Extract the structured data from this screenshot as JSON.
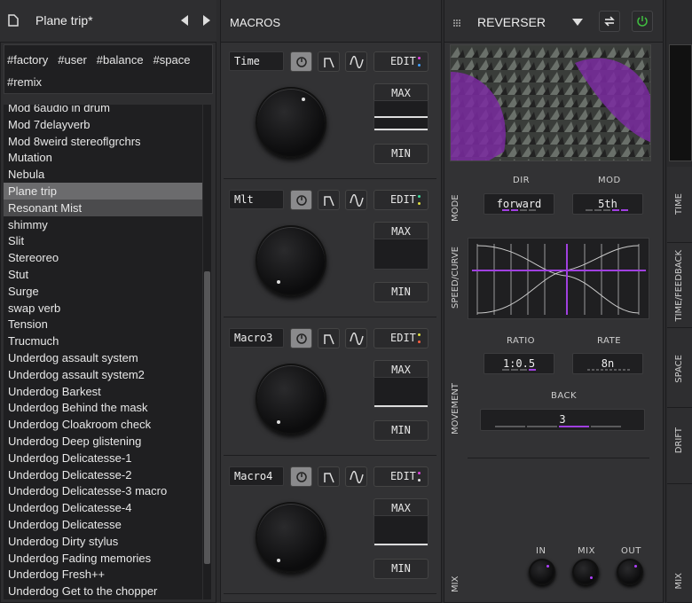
{
  "header": {
    "preset_name": "Plane trip*"
  },
  "tags": [
    "#factory",
    "#user",
    "#balance",
    "#space",
    "#remix"
  ],
  "presets": [
    "Mod 6audio in drum",
    "Mod 7delayverb",
    "Mod 8weird stereoflgrchrs",
    "Mutation",
    "Nebula",
    "Plane trip",
    "Resonant Mist",
    "shimmy",
    "Slit",
    "Stereoreo",
    "Stut",
    "Surge",
    "swap verb",
    "Tension",
    "Trucmuch",
    "Underdog assault system",
    "Underdog assault system2",
    "Underdog Barkest",
    "Underdog Behind the mask",
    "Underdog Cloakroom check",
    "Underdog Deep glistening",
    "Underdog Delicatesse-1",
    "Underdog Delicatesse-2",
    "Underdog Delicatesse-3 macro",
    "Underdog Delicatesse-4",
    "Underdog Delicatesse",
    "Underdog Dirty stylus",
    "Underdog Fading memories",
    "Underdog Fresh++",
    "Underdog Get to the chopper"
  ],
  "selected_preset": "Plane trip",
  "macros": {
    "title": "MACROS",
    "edit_label": "EDIT",
    "max_label": "MAX",
    "min_label": "MIN",
    "items": [
      {
        "name": "Time",
        "dots": [
          "#e040e0",
          "#40a0ff"
        ]
      },
      {
        "name": "Mlt",
        "dots": [
          "#40e0a0",
          "#e0e040"
        ]
      },
      {
        "name": "Macro3",
        "dots": [
          "#e0e040",
          "#ff6040"
        ]
      },
      {
        "name": "Macro4",
        "dots": [
          "#e040e0",
          "#e0e0e0"
        ]
      }
    ]
  },
  "reverser": {
    "title": "REVERSER",
    "sections": {
      "mode": "MODE",
      "speed_curve": "SPEED/CURVE",
      "movement": "MOVEMENT",
      "mix": "MIX"
    },
    "dir_label": "DIR",
    "dir_value": "forward",
    "mod_label": "MOD",
    "mod_value": "5th",
    "ratio_label": "RATIO",
    "ratio_value": "1:0.5",
    "rate_label": "RATE",
    "rate_value": "8n",
    "back_label": "BACK",
    "back_value": "3",
    "in_label": "IN",
    "mix_label": "MIX",
    "out_label": "OUT"
  },
  "side_tabs": [
    "TIME",
    "TIME/FEEDBACK",
    "SPACE",
    "DRIFT",
    "MIX"
  ],
  "colors": {
    "accent": "#a040e0",
    "power": "#40c040"
  }
}
